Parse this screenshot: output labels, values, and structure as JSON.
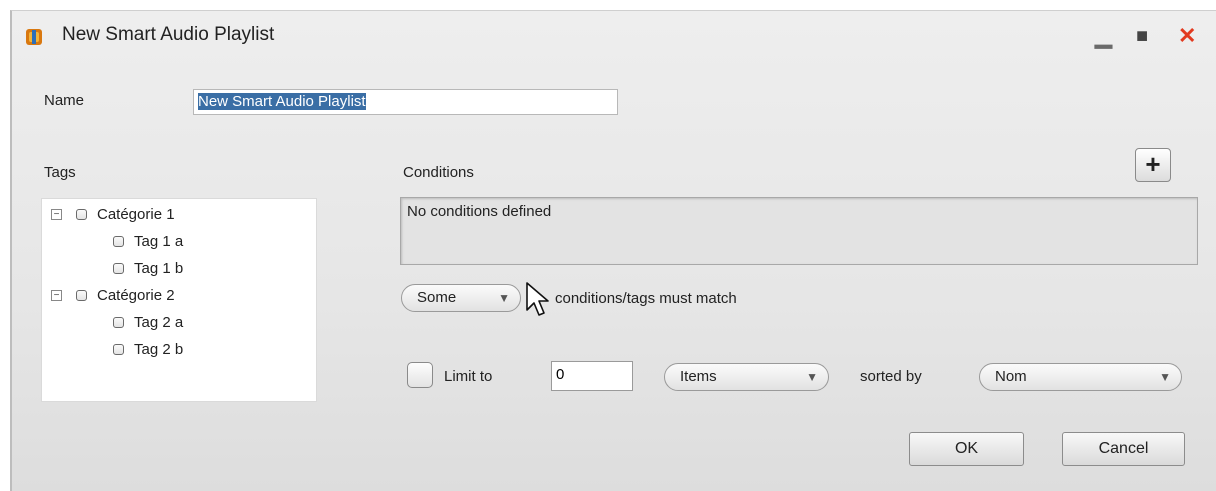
{
  "window": {
    "title": "New Smart Audio Playlist",
    "minimize": "▁",
    "maximize": "■",
    "close": "✕"
  },
  "name": {
    "label": "Name",
    "value": "New Smart Audio Playlist"
  },
  "tags": {
    "label": "Tags",
    "categories": [
      {
        "label": "Catégorie 1",
        "expander": "−",
        "items": [
          "Tag 1 a",
          "Tag 1 b"
        ]
      },
      {
        "label": "Catégorie 2",
        "expander": "−",
        "items": [
          "Tag 2 a",
          "Tag 2 b"
        ]
      }
    ]
  },
  "conditions": {
    "label": "Conditions",
    "add_symbol": "+",
    "empty_text": "No conditions defined"
  },
  "match": {
    "selected": "Some",
    "suffix": "conditions/tags must match"
  },
  "limit": {
    "label": "Limit to",
    "value": "0",
    "unit_selected": "Items",
    "sorted_by_label": "sorted by",
    "sort_selected": "Nom"
  },
  "buttons": {
    "ok": "OK",
    "cancel": "Cancel"
  },
  "colors": {
    "close": "#e23a1f",
    "selection": "#3a6ea5"
  },
  "icons": {
    "dropdown_arrow": "▼"
  }
}
